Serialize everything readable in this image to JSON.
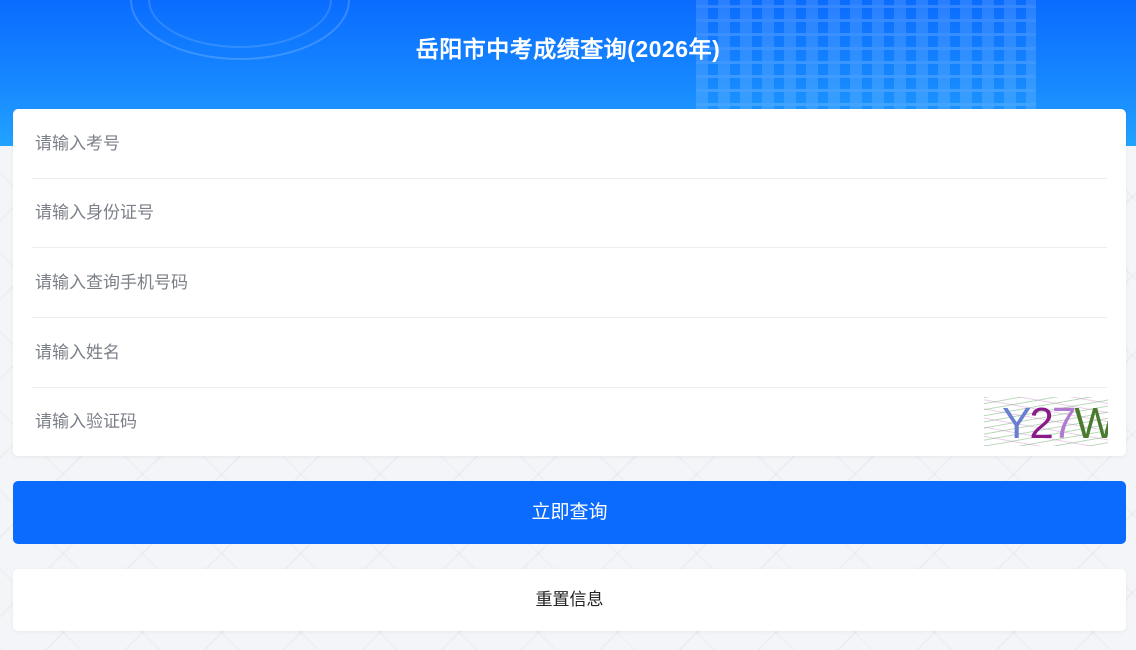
{
  "header": {
    "title": "岳阳市中考成绩查询(2026年)"
  },
  "form": {
    "exam_number_placeholder": "请输入考号",
    "id_card_placeholder": "请输入身份证号",
    "phone_placeholder": "请输入查询手机号码",
    "name_placeholder": "请输入姓名",
    "captcha_placeholder": "请输入验证码",
    "captcha_chars": [
      "Y",
      "2",
      "7",
      "W"
    ]
  },
  "buttons": {
    "query_label": "立即查询",
    "reset_label": "重置信息"
  },
  "colors": {
    "primary": "#0b6bff",
    "header_top": "#0a6cff",
    "header_bottom": "#22a3ff",
    "background": "#f4f5f8"
  }
}
